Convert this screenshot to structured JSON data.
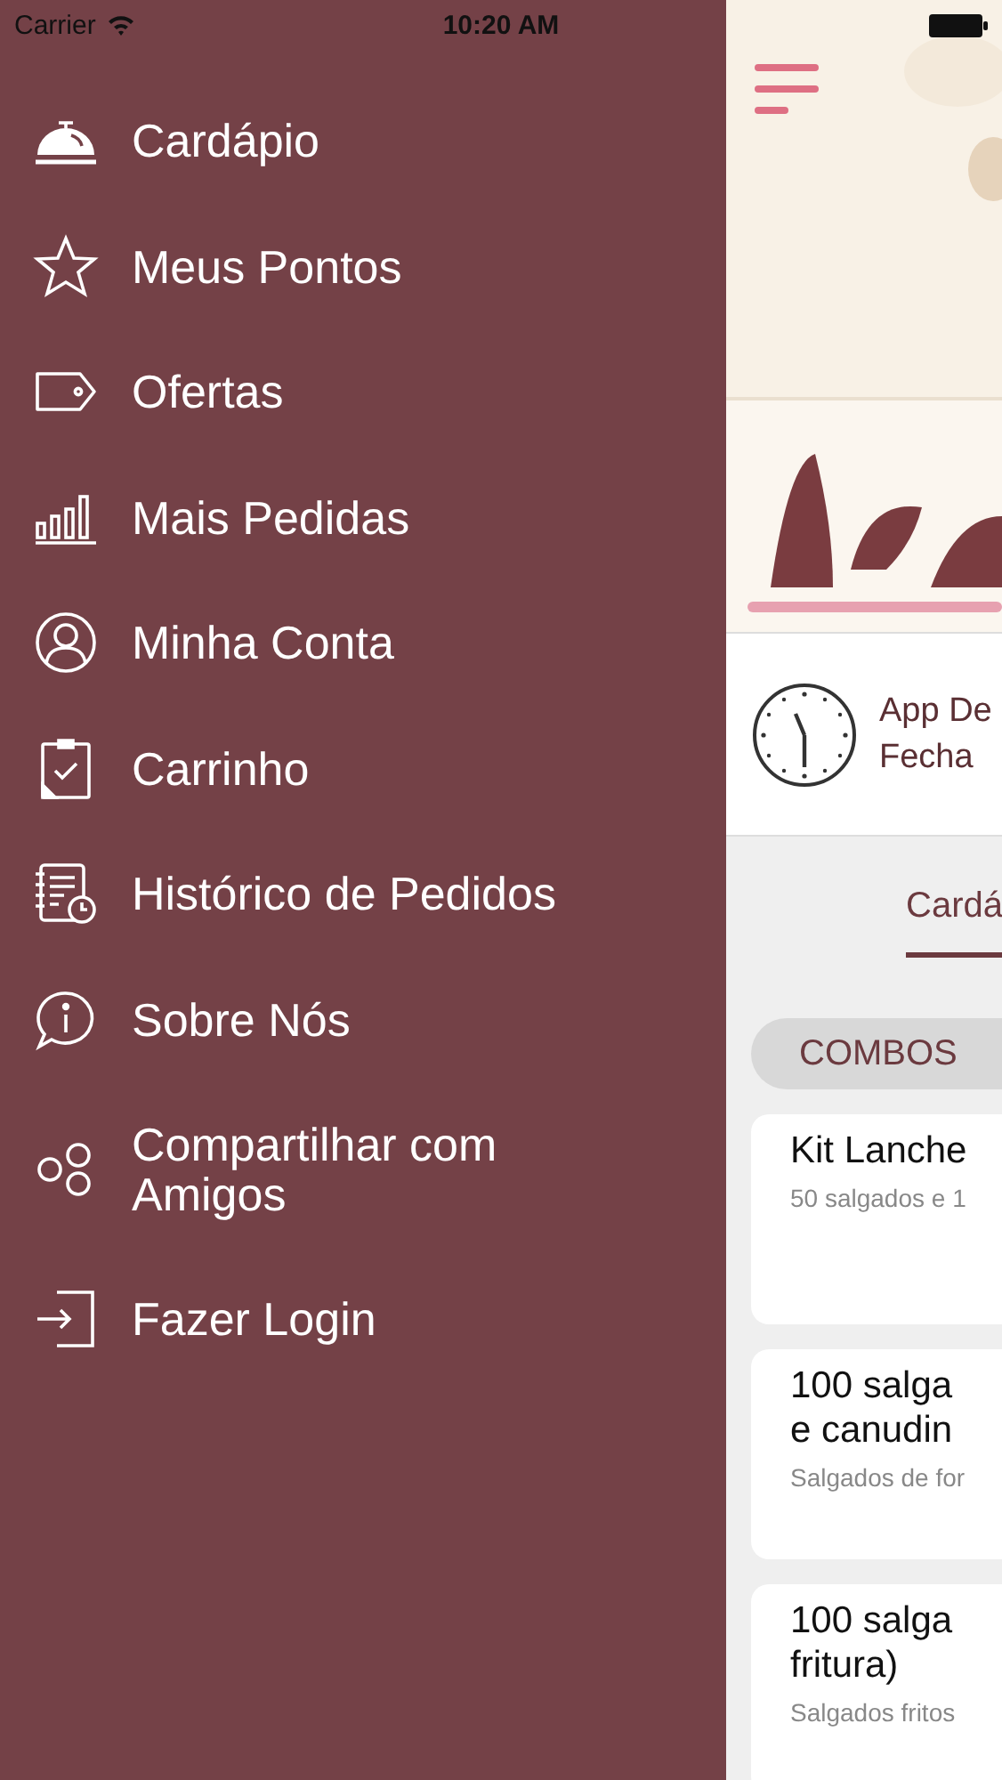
{
  "status_bar": {
    "carrier": "Carrier",
    "time": "10:20 AM"
  },
  "sidebar": {
    "items": [
      {
        "label": "Cardápio"
      },
      {
        "label": "Meus Pontos"
      },
      {
        "label": "Ofertas"
      },
      {
        "label": "Mais Pedidas"
      },
      {
        "label": "Minha Conta"
      },
      {
        "label": "Carrinho"
      },
      {
        "label": "Histórico de Pedidos"
      },
      {
        "label": "Sobre Nós"
      },
      {
        "label": "Compartilhar com Amigos"
      },
      {
        "label": "Fazer Login"
      }
    ]
  },
  "main": {
    "banner": {
      "kind": "picture"
    },
    "status_lines": [
      "App De",
      "Fecha"
    ],
    "tabs": [
      {
        "label": "Cardá",
        "selected": true
      }
    ],
    "category": "COMBOS",
    "products": [
      {
        "name": "Kit Lanche",
        "description": "50 salgados e 1"
      },
      {
        "name": "100 salga\ne canudin",
        "description": "Salgados de for"
      },
      {
        "name": "100 salga\nfritura)",
        "description": "Salgados fritos"
      }
    ]
  }
}
